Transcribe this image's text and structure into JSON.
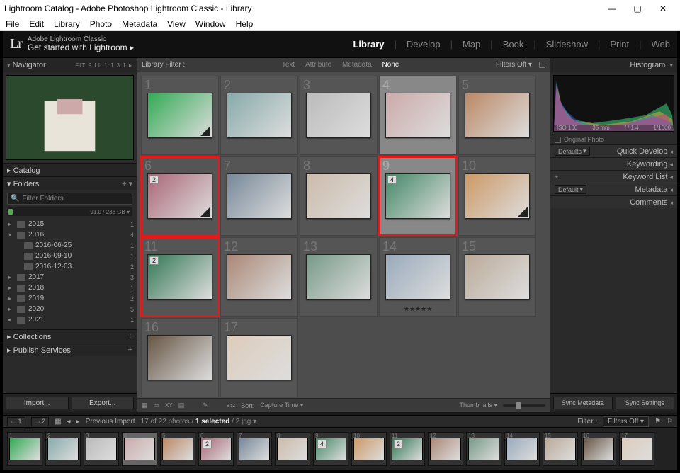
{
  "window": {
    "title": "Lightroom Catalog - Adobe Photoshop Lightroom Classic - Library"
  },
  "menubar": [
    "File",
    "Edit",
    "Library",
    "Photo",
    "Metadata",
    "View",
    "Window",
    "Help"
  ],
  "brand": {
    "logo": "Lr",
    "line1": "Adobe Lightroom Classic",
    "line2": "Get started with Lightroom ▸"
  },
  "modules": [
    "Library",
    "Develop",
    "Map",
    "Book",
    "Slideshow",
    "Print",
    "Web"
  ],
  "modules_active": "Library",
  "left": {
    "navigator": {
      "title": "Navigator",
      "opts": "FIT  FILL  1:1  3:1 ▸"
    },
    "catalog": "Catalog",
    "folders": {
      "title": "Folders",
      "filter_placeholder": "Filter Folders",
      "disk_text": "91.0 / 238 GB ▾"
    },
    "tree": [
      {
        "level": 0,
        "expand": "▸",
        "name": "2015",
        "count": "1"
      },
      {
        "level": 0,
        "expand": "▾",
        "name": "2016",
        "count": "4"
      },
      {
        "level": 1,
        "expand": "",
        "name": "2016-06-25",
        "count": "1"
      },
      {
        "level": 1,
        "expand": "",
        "name": "2016-09-10",
        "count": "1"
      },
      {
        "level": 1,
        "expand": "",
        "name": "2016-12-03",
        "count": "2"
      },
      {
        "level": 0,
        "expand": "▸",
        "name": "2017",
        "count": "3"
      },
      {
        "level": 0,
        "expand": "▸",
        "name": "2018",
        "count": "1"
      },
      {
        "level": 0,
        "expand": "▸",
        "name": "2019",
        "count": "2"
      },
      {
        "level": 0,
        "expand": "▸",
        "name": "2020",
        "count": "5"
      },
      {
        "level": 0,
        "expand": "▸",
        "name": "2021",
        "count": "1"
      }
    ],
    "collections": "Collections",
    "publish": "Publish Services",
    "import_btn": "Import...",
    "export_btn": "Export..."
  },
  "libfilter": {
    "label": "Library Filter :",
    "tabs": [
      "Text",
      "Attribute",
      "Metadata",
      "None"
    ],
    "active": "None",
    "filters_off": "Filters Off ▾"
  },
  "grid": [
    {
      "n": "1",
      "sel": false
    },
    {
      "n": "2",
      "sel": false
    },
    {
      "n": "3",
      "sel": false
    },
    {
      "n": "4",
      "sel": true
    },
    {
      "n": "5",
      "sel": false
    },
    {
      "n": "6",
      "sel": false,
      "hl": true,
      "badge": "2"
    },
    {
      "n": "7",
      "sel": false
    },
    {
      "n": "8",
      "sel": false
    },
    {
      "n": "9",
      "sel": true,
      "hl": true,
      "badge": "4"
    },
    {
      "n": "10",
      "sel": false
    },
    {
      "n": "11",
      "sel": false,
      "hl": true,
      "badge": "2"
    },
    {
      "n": "12",
      "sel": false
    },
    {
      "n": "13",
      "sel": false
    },
    {
      "n": "14",
      "sel": false,
      "stars": "★★★★★"
    },
    {
      "n": "15",
      "sel": false
    },
    {
      "n": "16",
      "sel": false
    },
    {
      "n": "17",
      "sel": false
    }
  ],
  "toolbar": {
    "sort_label": "Sort:",
    "sort_value": "Capture Time ▾",
    "thumbnails": "Thumbnails ▾"
  },
  "right": {
    "histogram": "Histogram",
    "hist_info": {
      "iso": "ISO 100",
      "focal": "35 mm",
      "ap": "f / 1.4",
      "sh": "1/1600"
    },
    "original": "Original Photo",
    "defaults": "Defaults",
    "default_lbl": "Default",
    "panels": [
      "Quick Develop",
      "Keywording",
      "Keyword List",
      "Metadata",
      "Comments"
    ],
    "sync1": "Sync Metadata",
    "sync2": "Sync Settings"
  },
  "filmstrip_bar": {
    "prev_import": "Previous Import",
    "status": "17 of 22 photos / 1 selected / 2.jpg ▾",
    "filter_label": "Filter :",
    "filters_off": "Filters Off ▾",
    "pages": [
      "1",
      "2"
    ]
  },
  "filmstrip": [
    {
      "n": "1"
    },
    {
      "n": "2"
    },
    {
      "n": "3"
    },
    {
      "n": "4",
      "sel": true
    },
    {
      "n": "5"
    },
    {
      "n": "6",
      "badge": "2"
    },
    {
      "n": "7"
    },
    {
      "n": "8"
    },
    {
      "n": "9",
      "badge": "4"
    },
    {
      "n": "10"
    },
    {
      "n": "11",
      "badge": "2"
    },
    {
      "n": "12"
    },
    {
      "n": "13"
    },
    {
      "n": "14"
    },
    {
      "n": "15"
    },
    {
      "n": "16"
    },
    {
      "n": "17"
    }
  ]
}
